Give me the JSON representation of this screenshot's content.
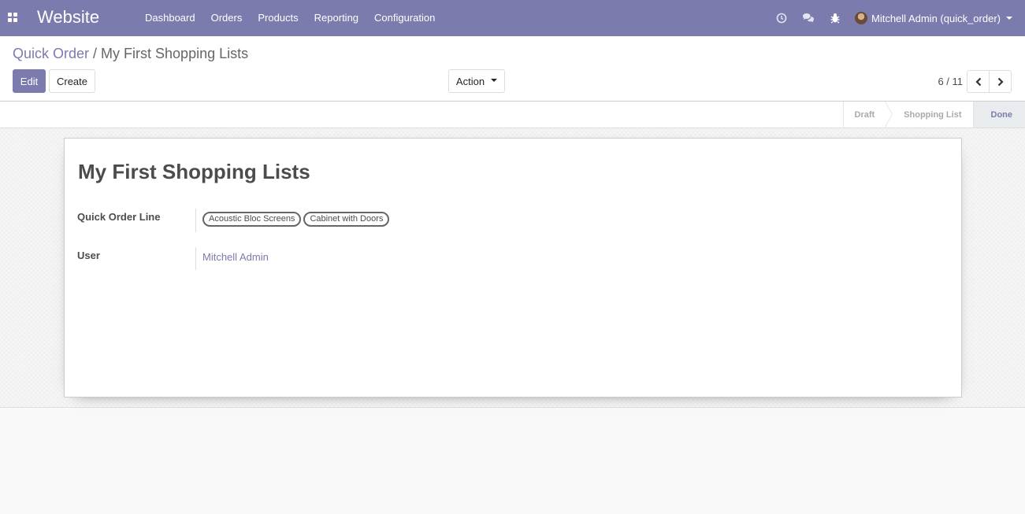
{
  "navbar": {
    "app_name": "Website",
    "menu": [
      "Dashboard",
      "Orders",
      "Products",
      "Reporting",
      "Configuration"
    ],
    "user_label": "Mitchell Admin (quick_order)",
    "color": "#7c7bad"
  },
  "breadcrumb": {
    "parent": "Quick Order",
    "separator": "/",
    "current": "My First Shopping Lists"
  },
  "buttons": {
    "edit": "Edit",
    "create": "Create",
    "action": "Action"
  },
  "pager": {
    "value": "6 / 11"
  },
  "statusbar": {
    "steps": [
      "Draft",
      "Shopping List",
      "Done"
    ],
    "active": "Done"
  },
  "record": {
    "title": "My First Shopping Lists",
    "fields": {
      "quick_order_line": {
        "label": "Quick Order Line",
        "tags": [
          "Acoustic Bloc Screens",
          "Cabinet with Doors"
        ]
      },
      "user": {
        "label": "User",
        "value": "Mitchell Admin"
      }
    }
  }
}
